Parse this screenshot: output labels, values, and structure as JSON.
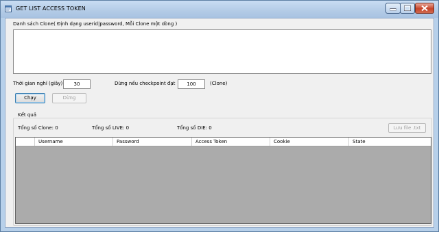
{
  "window": {
    "title": "GET LIST ACCESS TOKEN",
    "controls": [
      "minimize-icon",
      "maximize-icon",
      "close-icon"
    ]
  },
  "clone_list": {
    "label": "Danh sách Clone( Định dạng userid|password, Mỗi Clone một dòng )",
    "value": ""
  },
  "settings": {
    "rest_label": "Thời gian nghỉ (giây)",
    "rest_value": "30",
    "stop_label": "Dừng nếu checkpoint đạt",
    "stop_value": "100",
    "stop_unit": "(Clone)"
  },
  "buttons": {
    "run": "Chạy",
    "stop": "Dừng",
    "save": "Lưu file .txt"
  },
  "results": {
    "group_title": "Kết quả",
    "total_clone": "Tổng số Clone: 0",
    "total_live": "Tổng số LIVE: 0",
    "total_die": "Tổng số DIE: 0"
  },
  "table": {
    "columns": [
      "",
      "Username",
      "Password",
      "Access Token",
      "Cookie",
      "State"
    ],
    "rows": []
  }
}
